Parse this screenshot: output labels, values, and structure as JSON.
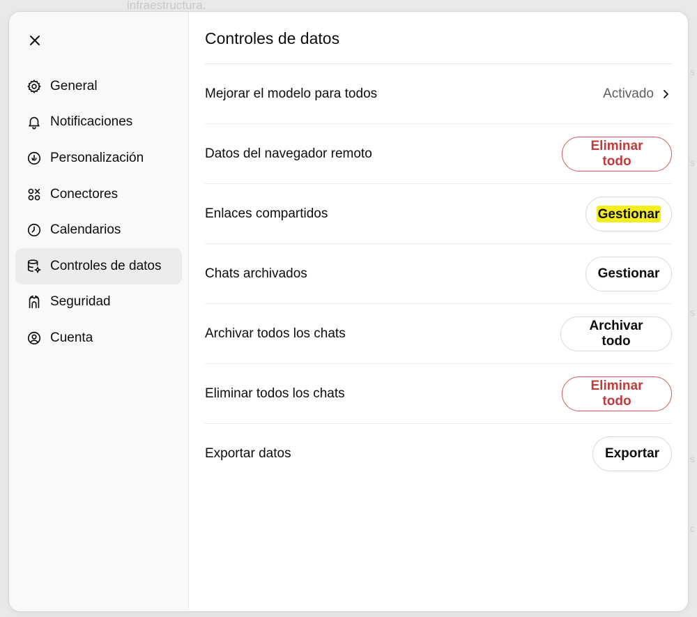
{
  "background": {
    "text": "infraestructura."
  },
  "sidebar": {
    "close_icon": "close-icon",
    "items": [
      {
        "label": "General",
        "icon": "gear-icon"
      },
      {
        "label": "Notificaciones",
        "icon": "bell-icon"
      },
      {
        "label": "Personalización",
        "icon": "personalization-icon"
      },
      {
        "label": "Conectores",
        "icon": "connectors-icon"
      },
      {
        "label": "Calendarios",
        "icon": "clock-icon"
      },
      {
        "label": "Controles de datos",
        "icon": "database-gear-icon",
        "active": true
      },
      {
        "label": "Seguridad",
        "icon": "security-icon"
      },
      {
        "label": "Cuenta",
        "icon": "account-icon"
      }
    ]
  },
  "main": {
    "title": "Controles de datos",
    "rows": [
      {
        "label": "Mejorar el modelo para todos",
        "status": "Activado"
      },
      {
        "label": "Datos del navegador remoto",
        "button": "Eliminar todo"
      },
      {
        "label": "Enlaces compartidos",
        "button": "Gestionar"
      },
      {
        "label": "Chats archivados",
        "button": "Gestionar"
      },
      {
        "label": "Archivar todos los chats",
        "button": "Archivar todo"
      },
      {
        "label": "Eliminar todos los chats",
        "button": "Eliminar todo"
      },
      {
        "label": "Exportar datos",
        "button": "Exportar"
      }
    ]
  },
  "colors": {
    "danger": "#c23a3a",
    "highlight": "#f5ee1e",
    "sidebar_bg": "#f9f9f9"
  }
}
